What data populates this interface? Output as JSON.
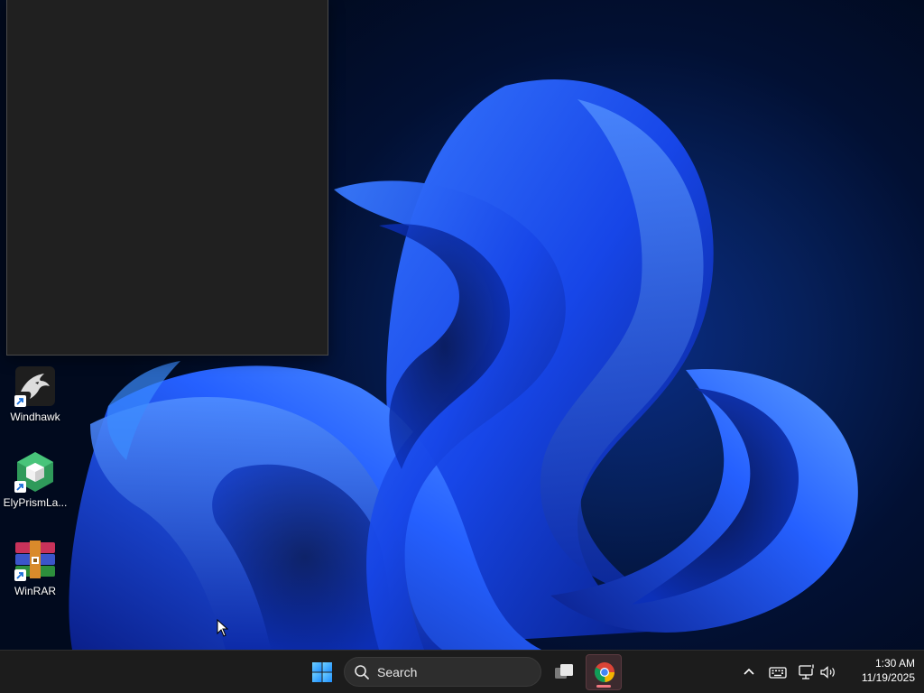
{
  "desktop": {
    "icons": [
      {
        "label": "Windhawk",
        "icon": "windhawk-icon"
      },
      {
        "label": "ElyPrismLa...",
        "icon": "elyprism-launcher-icon"
      },
      {
        "label": "WinRAR",
        "icon": "winrar-icon"
      }
    ]
  },
  "taskbar": {
    "start_icon": "windows-start-icon",
    "search": {
      "placeholder": "Search",
      "icon": "search-icon"
    },
    "pinned": [
      {
        "name": "task-view",
        "icon": "task-view-icon"
      },
      {
        "name": "chrome",
        "icon": "chrome-icon",
        "active": true
      }
    ],
    "tray": [
      {
        "name": "show-hidden-icons",
        "icon": "chevron-up-icon"
      },
      {
        "name": "keyboard",
        "icon": "keyboard-icon"
      },
      {
        "name": "network",
        "icon": "network-icon"
      },
      {
        "name": "volume",
        "icon": "volume-icon"
      }
    ],
    "clock": {
      "time": "1:30 AM",
      "date": "11/19/2025"
    }
  },
  "colors": {
    "taskbar_bg": "#1c1c1c",
    "window_bg": "#202020",
    "wallpaper_accent": "#1f4cff",
    "active_indicator": "#f0767f"
  }
}
